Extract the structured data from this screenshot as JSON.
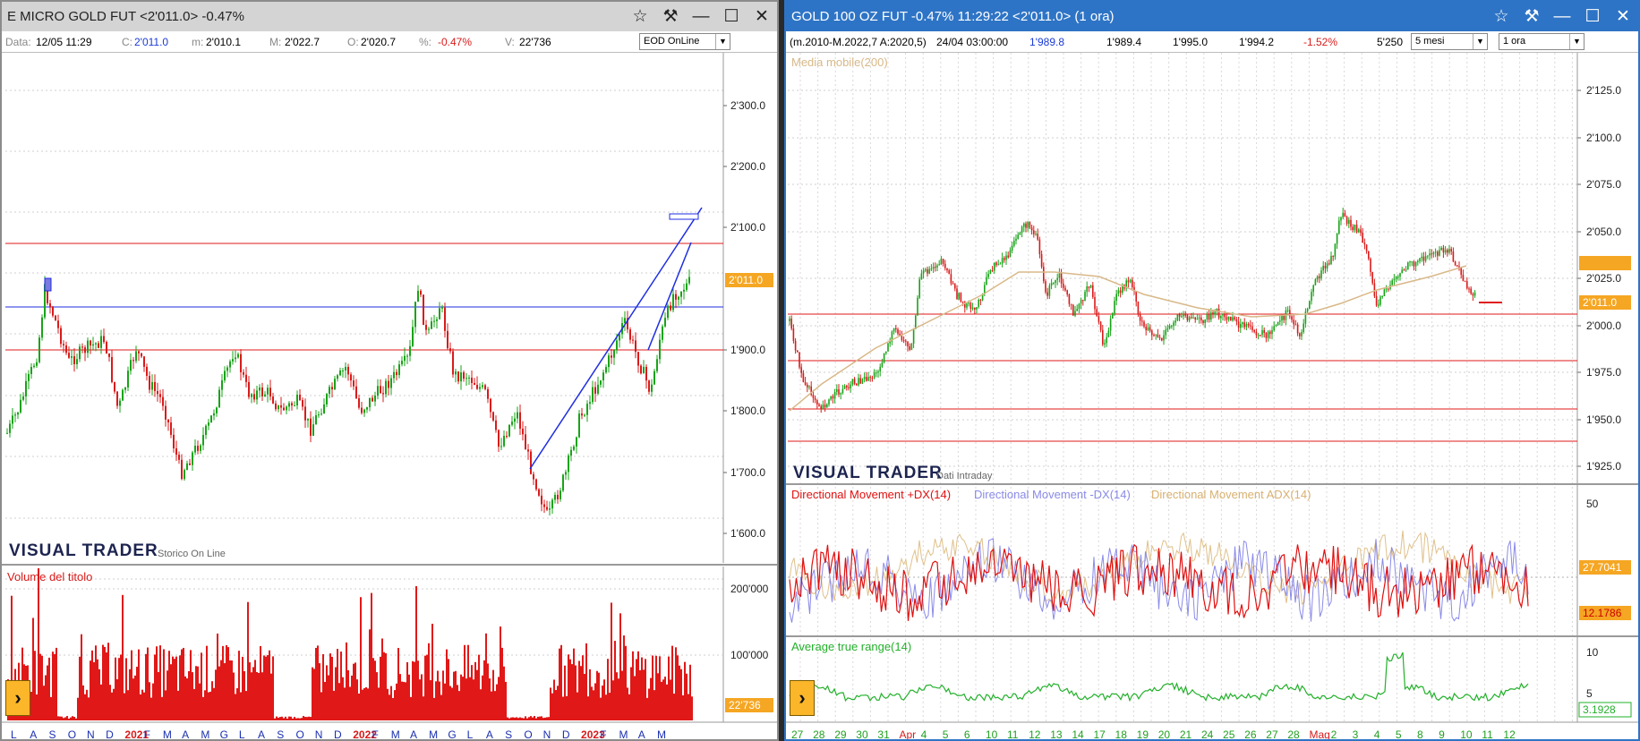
{
  "left": {
    "title": "E MICRO GOLD FUT <2'011.0> -0.47%",
    "info": {
      "data_lbl": "Data:",
      "data": "12/05 11:29",
      "c_lbl": "C:",
      "c": "2'011.0",
      "m_lbl": "m:",
      "m": "2'010.1",
      "M_lbl": "M:",
      "M": "2'022.7",
      "O_lbl": "O:",
      "O": "2'020.7",
      "pct_lbl": "%:",
      "pct": "-0.47%",
      "v_lbl": "V:",
      "v": "22'736"
    },
    "mode_select": "EOD OnLine",
    "price_axis": [
      "2'300.0",
      "2'200.0",
      "2'100.0",
      "1'900.0",
      "1'800.0",
      "1'700.0",
      "1'600.0"
    ],
    "last_price_tag": "2'011.0",
    "brand": "VISUAL TRADER",
    "brand_sub": "Storico On Line",
    "volume_title": "Volume del titolo",
    "volume_axis": [
      "200'000",
      "100'000"
    ],
    "last_volume_tag": "22'736",
    "x_axis": [
      "L",
      "A",
      "S",
      "O",
      "N",
      "D",
      "2021",
      "F",
      "M",
      "A",
      "M",
      "G",
      "L",
      "A",
      "S",
      "O",
      "N",
      "D",
      "2022",
      "F",
      "M",
      "A",
      "M",
      "G",
      "L",
      "A",
      "S",
      "O",
      "N",
      "D",
      "2023",
      "F",
      "M",
      "A",
      "M"
    ]
  },
  "right": {
    "title": "GOLD 100 OZ FUT -0.47% 11:29:22  <2'011.0> (1 ora)",
    "info": {
      "formula": "(m.2010-M.2022,7 A:2020,5)",
      "date": "24/04 03:00:00",
      "v1": "1'989.8",
      "v2": "1'989.4",
      "v3": "1'995.0",
      "v4": "1'994.2",
      "pct": "-1.52%",
      "vol": "5'250"
    },
    "period_select": "5 mesi",
    "interval_select": "1 ora",
    "ma_label": "Media mobile(200)",
    "price_axis": [
      "2'125.0",
      "2'100.0",
      "2'075.0",
      "2'050.0",
      "2'025.0",
      "2'000.0",
      "1'975.0",
      "1'950.0",
      "1'925.0"
    ],
    "last_price_tag": "2'011.0",
    "brand": "VISUAL TRADER",
    "brand_sub": "Dati Intraday",
    "dm_plus": "Directional Movement +DX(14)",
    "dm_minus": "Directional Movement -DX(14)",
    "dm_adx": "Directional Movement ADX(14)",
    "dm_axis_top": "50",
    "dm_tag1": "27.7041",
    "dm_tag2": "12.1786",
    "atr_label": "Average true range(14)",
    "atr_axis": [
      "10",
      "5"
    ],
    "atr_tag": "3.1928",
    "x_axis": [
      "27",
      "28",
      "29",
      "30",
      "31",
      "Apr",
      "4",
      "5",
      "6",
      "10",
      "11",
      "12",
      "13",
      "14",
      "17",
      "18",
      "19",
      "20",
      "21",
      "24",
      "25",
      "26",
      "27",
      "28",
      "Mag",
      "2",
      "3",
      "4",
      "5",
      "8",
      "9",
      "10",
      "11",
      "12"
    ]
  },
  "colors": {
    "up": "#19a319",
    "down": "#d81b1b",
    "hline": "#e01818",
    "blue": "#1f2ee0",
    "ma": "#d8b888",
    "tag": "#f5a623",
    "dxp": "#e01010",
    "dxm": "#8a8ae8",
    "adx": "#e0c08a",
    "atr": "#22b02a"
  }
}
